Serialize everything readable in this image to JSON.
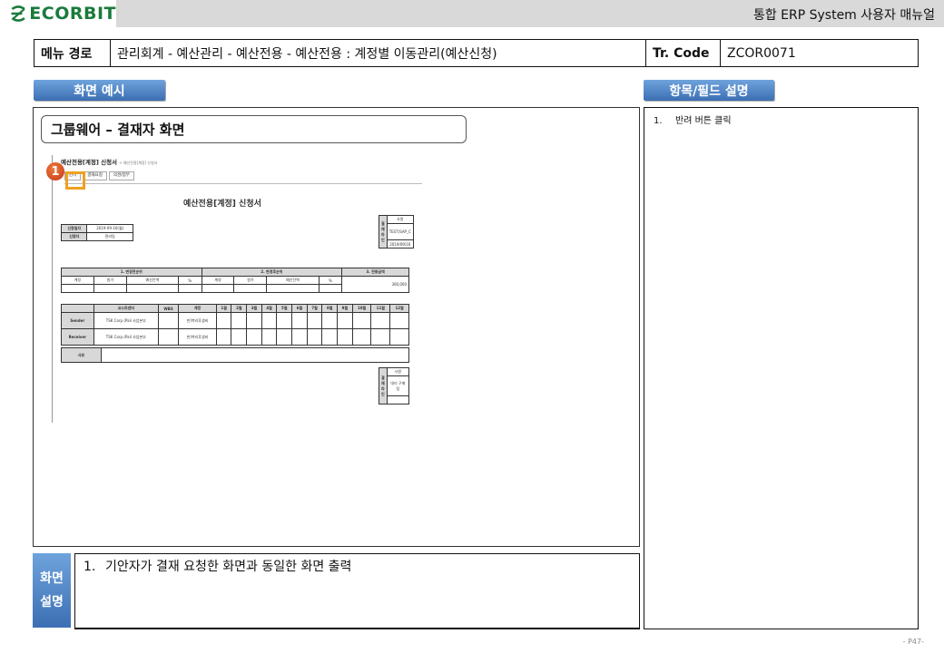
{
  "header": {
    "logo_text": "ECORBIT",
    "manual_title": "통합 ERP System 사용자 매뉴얼"
  },
  "info": {
    "menu_label": "메뉴 경로",
    "menu_path": "관리회계 - 예산관리 - 예산전용 - 예산전용 : 계정별 이동관리(예산신청)",
    "tr_label": "Tr. Code",
    "tr_code": "ZCOR0071"
  },
  "sections": {
    "screen_example": "화면 예시",
    "field_desc": "항목/필드 설명"
  },
  "screen": {
    "subtitle": "그룹웨어 – 결재자 화면",
    "marker": "1",
    "mini": {
      "header": "예산전용[계정] 신청서",
      "header_sub": "> 예산전용[계정] 신청서",
      "tabs": [
        "반려",
        "결재요청",
        "의견/첨부"
      ],
      "doc_title": "예산전용[계정] 신청서",
      "apply_rows": [
        {
          "label": "신청일자",
          "value": "2019-09-16(월)"
        },
        {
          "label": "신청자",
          "value": "관리팀"
        }
      ],
      "approval": {
        "title": "사원",
        "side": "결재 라인",
        "name": "TEST(SAP_C",
        "date": "2019/09/16"
      },
      "transfer_headers": [
        "1. 변경전순위",
        "2. 변경후순위",
        "3. 전용금액"
      ],
      "transfer_cols": [
        "계정",
        "원가",
        "예산잔액",
        "%",
        "계정",
        "원가",
        "예산잔액",
        "%"
      ],
      "transfer_amount": "300,000",
      "month_headers": [
        "코스트센터",
        "WBS",
        "계정",
        "1월",
        "2월",
        "3월",
        "4월",
        "5월",
        "6월",
        "7월",
        "8월",
        "9월",
        "10월",
        "11월",
        "12월"
      ],
      "sender_label": "Sender",
      "sender_cc": "TSK Corp.(Pali 사업본부",
      "sender_acct": "판)복리후생비",
      "receiver_label": "Receiver",
      "receiver_cc": "TSK Corp.(Pali 사업본부",
      "receiver_acct": "판)복리후생비",
      "reason_label": "사유",
      "approver": {
        "title": "사원",
        "side": "결재 라인",
        "name": "대리 구매팀"
      }
    }
  },
  "fields": [
    {
      "num": "1.",
      "text": "반려 버튼 클릭"
    }
  ],
  "description": {
    "label_1": "화면",
    "label_2": "설명",
    "items": [
      {
        "num": "1.",
        "text": "기안자가 결재 요청한 화면과 동일한 화면 출력"
      }
    ]
  },
  "page_number": "- P47-"
}
